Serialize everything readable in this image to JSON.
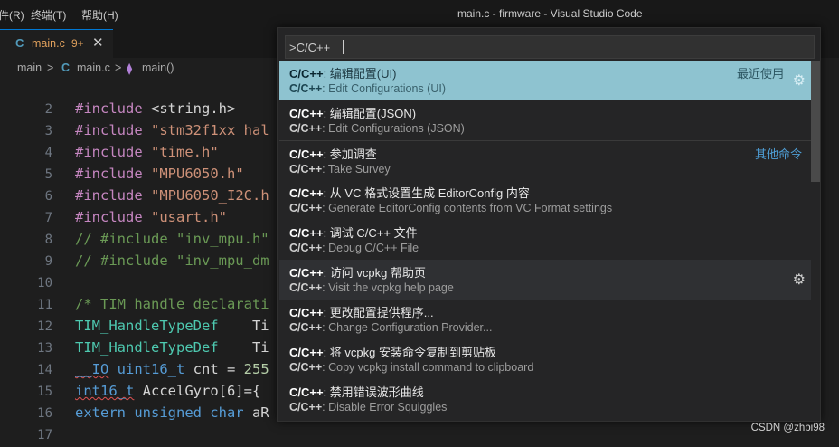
{
  "titlebar": {
    "menu": [
      "件(R)",
      "终端(T)",
      "帮助(H)"
    ],
    "window_title": "main.c - firmware - Visual Studio Code"
  },
  "tab": {
    "icon": "C",
    "name": "main.c",
    "modified": "9+",
    "close": "✕"
  },
  "breadcrumb": {
    "folder": "main",
    "sep1": ">",
    "file_icon": "C",
    "file": "main.c",
    "sep2": ">",
    "symbol_icon": "⧫",
    "symbol": "main()"
  },
  "editor": {
    "lines": [
      {
        "n": "2",
        "parts": [
          [
            "pp",
            "#include "
          ],
          [
            "tx",
            "<string.h>"
          ]
        ]
      },
      {
        "n": "3",
        "parts": [
          [
            "pp",
            "#include "
          ],
          [
            "str",
            "\"stm32f1xx_hal"
          ]
        ]
      },
      {
        "n": "4",
        "parts": [
          [
            "pp",
            "#include "
          ],
          [
            "str",
            "\"time.h\""
          ]
        ]
      },
      {
        "n": "5",
        "parts": [
          [
            "pp",
            "#include "
          ],
          [
            "str",
            "\"MPU6050.h\""
          ]
        ]
      },
      {
        "n": "6",
        "parts": [
          [
            "pp",
            "#include "
          ],
          [
            "str",
            "\"MPU6050_I2C.h"
          ]
        ]
      },
      {
        "n": "7",
        "parts": [
          [
            "pp",
            "#include "
          ],
          [
            "str",
            "\"usart.h\""
          ]
        ]
      },
      {
        "n": "8",
        "parts": [
          [
            "cm",
            "// #include \"inv_mpu.h\""
          ]
        ]
      },
      {
        "n": "9",
        "parts": [
          [
            "cm",
            "// #include \"inv_mpu_dm"
          ]
        ]
      },
      {
        "n": "10",
        "parts": []
      },
      {
        "n": "11",
        "parts": [
          [
            "cm",
            "/* TIM handle declarati"
          ]
        ]
      },
      {
        "n": "12",
        "parts": [
          [
            "ty",
            "TIM_HandleTypeDef"
          ],
          [
            "tx",
            "    Ti"
          ]
        ]
      },
      {
        "n": "13",
        "parts": [
          [
            "ty",
            "TIM_HandleTypeDef"
          ],
          [
            "tx",
            "    Ti"
          ]
        ]
      },
      {
        "n": "14",
        "parts": [
          [
            "kw2sq",
            "__IO"
          ],
          [
            "tx",
            " "
          ],
          [
            "kw2",
            "uint16_t"
          ],
          [
            "tx",
            " cnt = "
          ],
          [
            "num",
            "255"
          ]
        ]
      },
      {
        "n": "15",
        "parts": [
          [
            "kw2sq",
            "int16_t"
          ],
          [
            "tx",
            " AccelGyro[6]={"
          ]
        ]
      },
      {
        "n": "16",
        "parts": [
          [
            "kw2",
            "extern unsigned char"
          ],
          [
            "tx",
            " aR"
          ]
        ]
      },
      {
        "n": "17",
        "parts": []
      }
    ]
  },
  "palette": {
    "query": ">C/C++",
    "items": [
      {
        "prefix": "C/C++",
        "title": ": 编辑配置(UI)",
        "sub": ": Edit Configurations (UI)",
        "tag": "最近使用",
        "gear": "⚙"
      },
      {
        "prefix": "C/C++",
        "title": ": 编辑配置(JSON)",
        "sub": ": Edit Configurations (JSON)",
        "tag": "",
        "gear": ""
      },
      {
        "prefix": "C/C++",
        "title": ": 参加调查",
        "sub": ": Take Survey",
        "tag": "其他命令",
        "gear": ""
      },
      {
        "prefix": "C/C++",
        "title": ": 从 VC 格式设置生成 EditorConfig 内容",
        "sub": ": Generate EditorConfig contents from VC Format settings",
        "tag": "",
        "gear": ""
      },
      {
        "prefix": "C/C++",
        "title": ": 调试 C/C++ 文件",
        "sub": ": Debug C/C++ File",
        "tag": "",
        "gear": ""
      },
      {
        "prefix": "C/C++",
        "title": ": 访问 vcpkg 帮助页",
        "sub": ": Visit the vcpkg help page",
        "tag": "",
        "gear": "⚙"
      },
      {
        "prefix": "C/C++",
        "title": ": 更改配置提供程序...",
        "sub": ": Change Configuration Provider...",
        "tag": "",
        "gear": ""
      },
      {
        "prefix": "C/C++",
        "title": ": 将 vcpkg 安装命令复制到剪贴板",
        "sub": ": Copy vcpkg install command to clipboard",
        "tag": "",
        "gear": ""
      },
      {
        "prefix": "C/C++",
        "title": ": 禁用错误波形曲线",
        "sub": ": Disable Error Squiggles",
        "tag": "",
        "gear": ""
      }
    ]
  },
  "watermark": "CSDN @zhbi98"
}
